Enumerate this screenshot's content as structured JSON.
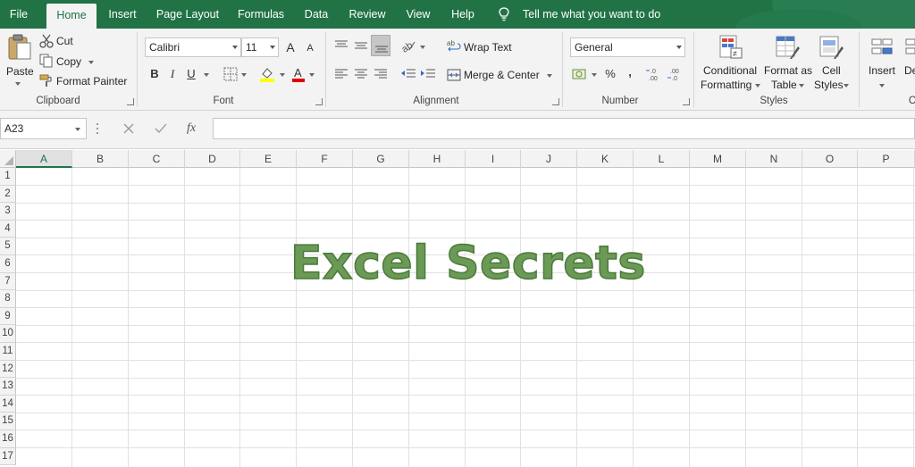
{
  "menu": {
    "tabs": [
      "File",
      "Home",
      "Insert",
      "Page Layout",
      "Formulas",
      "Data",
      "Review",
      "View",
      "Help"
    ],
    "tell_me": "Tell me what you want to do"
  },
  "ribbon": {
    "clipboard": {
      "paste": "Paste",
      "cut": "Cut",
      "copy": "Copy",
      "format_painter": "Format Painter",
      "label": "Clipboard"
    },
    "font": {
      "name": "Calibri",
      "size": "11",
      "bold": "B",
      "italic": "I",
      "underline": "U",
      "grow": "A",
      "shrink": "A",
      "label": "Font"
    },
    "alignment": {
      "wrap_text": "Wrap Text",
      "merge_center": "Merge & Center",
      "label": "Alignment"
    },
    "number": {
      "format": "General",
      "percent": "%",
      "comma": ",",
      "label": "Number"
    },
    "styles": {
      "conditional": "Conditional",
      "formatting": "Formatting",
      "format_as": "Format as",
      "table": "Table",
      "cell": "Cell",
      "cell_styles": "Styles",
      "label": "Styles"
    },
    "cells": {
      "insert": "Insert",
      "delete": "De",
      "label": "C"
    }
  },
  "formula_bar": {
    "name_box": "A23",
    "fx": "fx",
    "value": ""
  },
  "sheet": {
    "columns": [
      "A",
      "B",
      "C",
      "D",
      "E",
      "F",
      "G",
      "H",
      "I",
      "J",
      "K",
      "L",
      "M",
      "N",
      "O",
      "P"
    ],
    "rows": [
      "1",
      "2",
      "3",
      "4",
      "5",
      "6",
      "7",
      "8",
      "9",
      "10",
      "11",
      "12",
      "13",
      "14",
      "15",
      "16",
      "17"
    ],
    "selected_column": "A",
    "title_text": "Excel Secrets"
  },
  "colors": {
    "accent": "#217346",
    "title_fill": "#6a9a55"
  }
}
